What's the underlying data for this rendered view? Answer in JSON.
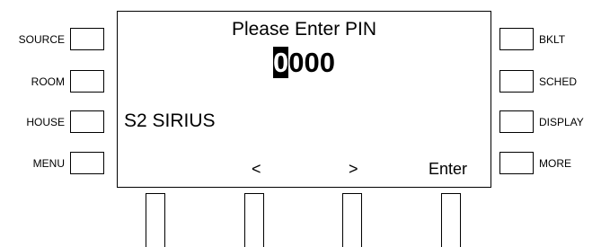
{
  "left_buttons": [
    {
      "label": "SOURCE"
    },
    {
      "label": "ROOM"
    },
    {
      "label": "HOUSE"
    },
    {
      "label": "MENU"
    }
  ],
  "right_buttons": [
    {
      "label": "BKLT"
    },
    {
      "label": "SCHED"
    },
    {
      "label": "DISPLAY"
    },
    {
      "label": "MORE"
    }
  ],
  "screen": {
    "title": "Please Enter PIN",
    "pin_cursor_digit": "0",
    "pin_rest": "000",
    "source": "S2 SIRIUS",
    "softkeys": [
      "<",
      ">",
      "Enter"
    ]
  }
}
